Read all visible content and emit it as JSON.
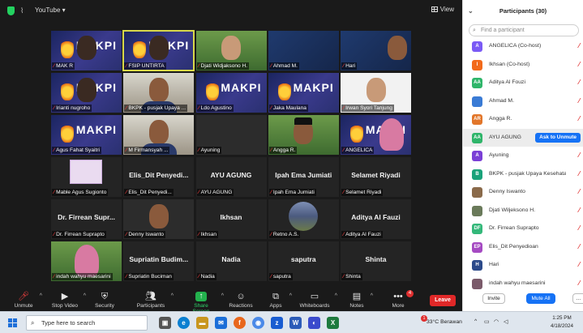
{
  "topbar": {
    "youtube": "YouTube ▾",
    "view": "View"
  },
  "tiles": [
    [
      "MAK R",
      "FSIP UNTIRTA",
      "Djati Widjaksono H.",
      "Ahmad M.",
      "Hari"
    ],
    [
      "Irianti nugroho",
      "BKPK - pusjak Upaya ...",
      "Ldo Agustino",
      "Jaka Maulana",
      "Irwan Syori Tanjung"
    ],
    [
      "Agus Fahat Syaitri",
      "M Firmansyah ...",
      "Ayuning",
      "Angga R.",
      "ANGELICA"
    ],
    [
      "Mable Agus Sugionto",
      "Elis_Dit Penyedi...",
      "AYU AGUNG",
      "Ipah Ema Jumiati",
      "Selamet Riyadi"
    ],
    [
      "Dr. Firrean Suprapto",
      "Denny Iswanto",
      "Ikhsan",
      "Retno A.S.",
      "Aditya Al Fauzi"
    ],
    [
      "indah wahyu maesarini",
      "Supriatin Buciman",
      "Nadia",
      "saputra",
      "Shinta"
    ]
  ],
  "tile_big": {
    "r3c1": "Elis_Dit Penyedi...",
    "r3c2": "AYU AGUNG",
    "r3c3": "Ipah Ema Jumiati",
    "r3c4": "Selamet Riyadi",
    "r4c0": "Dr. Firrean Supr...",
    "r4c2": "Ikhsan",
    "r4c4": "Aditya Al Fauzi",
    "r5c1": "Supriatin Budim...",
    "r5c2": "Nadia",
    "r5c3": "saputra",
    "r5c4": "Shinta"
  },
  "tile_logo": "MAKPI",
  "toolbar": {
    "unmute": "Unmute",
    "stop_video": "Stop Video",
    "security": "Security",
    "participants": "Participants",
    "participants_count": "30",
    "share_screen": "Share Screen",
    "reactions": "Reactions",
    "apps": "Apps",
    "whiteboards": "Whiteboards",
    "notes": "Notes",
    "more": "More",
    "more_badge": "4",
    "leave": "Leave"
  },
  "panel": {
    "title": "Participants (30)",
    "search_placeholder": "Find a participant",
    "rows": [
      {
        "initials": "A",
        "color": "#7a5af5",
        "name": "ANGELICA (Co-host)",
        "unmute": ""
      },
      {
        "initials": "I",
        "color": "#f26a1b",
        "name": "Ikhsan (Co-host)",
        "unmute": ""
      },
      {
        "initials": "AA",
        "color": "#2fb56a",
        "name": "Aditya Al Fouzi",
        "unmute": ""
      },
      {
        "initials": "",
        "color": "#3a7bd5",
        "name": "Ahmad M.",
        "unmute": ""
      },
      {
        "initials": "AR",
        "color": "#e2762a",
        "name": "Angga R.",
        "unmute": ""
      },
      {
        "initials": "AA",
        "color": "#2fb56a",
        "name": "AYU AGUNG",
        "unmute": "Ask to Unmute"
      },
      {
        "initials": "A",
        "color": "#7a3fd6",
        "name": "Ayuning",
        "unmute": ""
      },
      {
        "initials": "B",
        "color": "#1aa27a",
        "name": "BKPK - pusjak Upaya Kesehata...",
        "unmute": ""
      },
      {
        "initials": "",
        "color": "#8a6a4a",
        "name": "Denny Iswanto",
        "unmute": ""
      },
      {
        "initials": "",
        "color": "#6a7a5a",
        "name": "Djati Wiljeksono H.",
        "unmute": ""
      },
      {
        "initials": "DF",
        "color": "#34b87a",
        "name": "Dr. Firrean Suprapto",
        "unmute": ""
      },
      {
        "initials": "EP",
        "color": "#a54ac2",
        "name": "Elis_Dit Penyedioan",
        "unmute": ""
      },
      {
        "initials": "H",
        "color": "#2c4a8a",
        "name": "Hari",
        "unmute": ""
      },
      {
        "initials": "",
        "color": "#7a5a6a",
        "name": "indah wahyu maesarini",
        "unmute": ""
      }
    ],
    "invite": "Invite",
    "mute_all": "Mute All",
    "more": "..."
  },
  "taskbar": {
    "search_placeholder": "Type here to search",
    "weather": "33°C  Berawan",
    "time": "1:25 PM",
    "date": "4/18/2024",
    "notif_count": "1"
  }
}
